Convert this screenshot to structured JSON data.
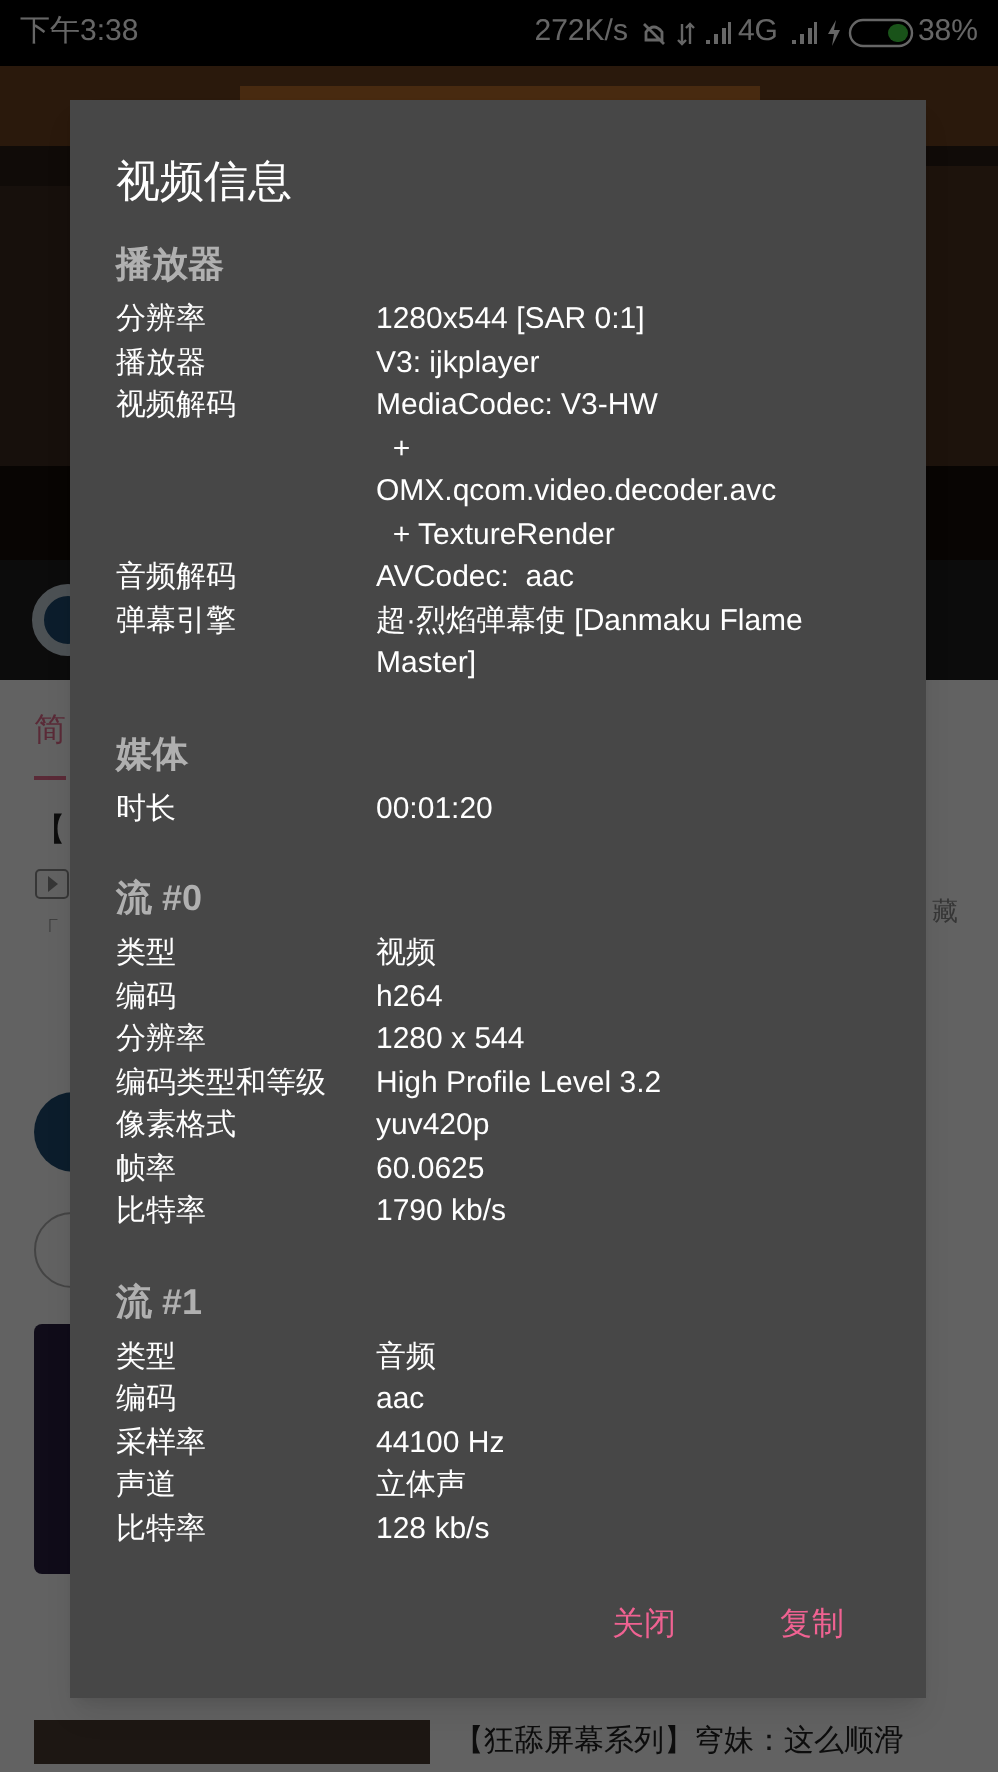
{
  "status_bar": {
    "time": "下午3:38",
    "speed": "272K/s",
    "network": "4G",
    "battery": "38%"
  },
  "background": {
    "tab": "简",
    "item_title": "【",
    "item_desc": "「",
    "side_label": "藏",
    "bottom_title": "【狂舔屏幕系列】穹妹：这么顺滑"
  },
  "dialog": {
    "title": "视频信息",
    "sections": [
      {
        "heading": "播放器",
        "rows": [
          {
            "label": "分辨率",
            "value": "1280x544 [SAR 0:1]"
          },
          {
            "label": "播放器",
            "value": "V3: ijkplayer"
          },
          {
            "label": "视频解码",
            "value": "MediaCodec: V3-HW\n  +\nOMX.qcom.video.decoder.avc\n  + TextureRender"
          },
          {
            "label": "音频解码",
            "value": "AVCodec:  aac"
          },
          {
            "label": "弹幕引擎",
            "value": "超·烈焰弹幕使 [Danmaku Flame Master]"
          }
        ]
      },
      {
        "heading": "媒体",
        "rows": [
          {
            "label": "时长",
            "value": "00:01:20"
          }
        ]
      },
      {
        "heading": "流 #0",
        "rows": [
          {
            "label": "类型",
            "value": "视频"
          },
          {
            "label": "编码",
            "value": "h264"
          },
          {
            "label": "分辨率",
            "value": "1280 x 544"
          },
          {
            "label": "编码类型和等级",
            "value": "High Profile Level 3.2"
          },
          {
            "label": "像素格式",
            "value": "yuv420p"
          },
          {
            "label": "帧率",
            "value": "60.0625"
          },
          {
            "label": "比特率",
            "value": "1790 kb/s"
          }
        ]
      },
      {
        "heading": "流 #1",
        "rows": [
          {
            "label": "类型",
            "value": "音频"
          },
          {
            "label": "编码",
            "value": "aac"
          },
          {
            "label": "采样率",
            "value": "44100 Hz"
          },
          {
            "label": "声道",
            "value": "立体声"
          },
          {
            "label": "比特率",
            "value": "128 kb/s"
          }
        ]
      }
    ],
    "buttons": [
      "关闭",
      "复制"
    ]
  }
}
